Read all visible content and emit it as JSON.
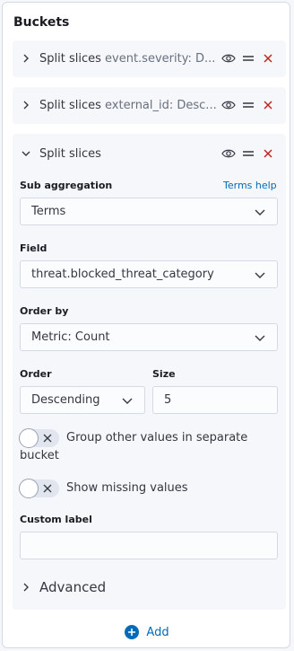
{
  "title": "Buckets",
  "buckets": [
    {
      "label": "Split slices",
      "desc": "event.severity: D..."
    },
    {
      "label": "Split slices",
      "desc": "external_id: Desc..."
    },
    {
      "label": "Split slices",
      "desc": ""
    }
  ],
  "form": {
    "sub_aggregation_label": "Sub aggregation",
    "terms_help": "Terms help",
    "sub_aggregation_value": "Terms",
    "field_label": "Field",
    "field_value": "threat.blocked_threat_category",
    "order_by_label": "Order by",
    "order_by_value": "Metric: Count",
    "order_label": "Order",
    "order_value": "Descending",
    "size_label": "Size",
    "size_value": "5",
    "group_other_label": "Group other values in separate bucket",
    "show_missing_label": "Show missing values",
    "custom_label_label": "Custom label",
    "custom_label_value": ""
  },
  "advanced_label": "Advanced",
  "add_label": "Add",
  "colors": {
    "accent": "#006bb8",
    "danger": "#bd271e"
  }
}
